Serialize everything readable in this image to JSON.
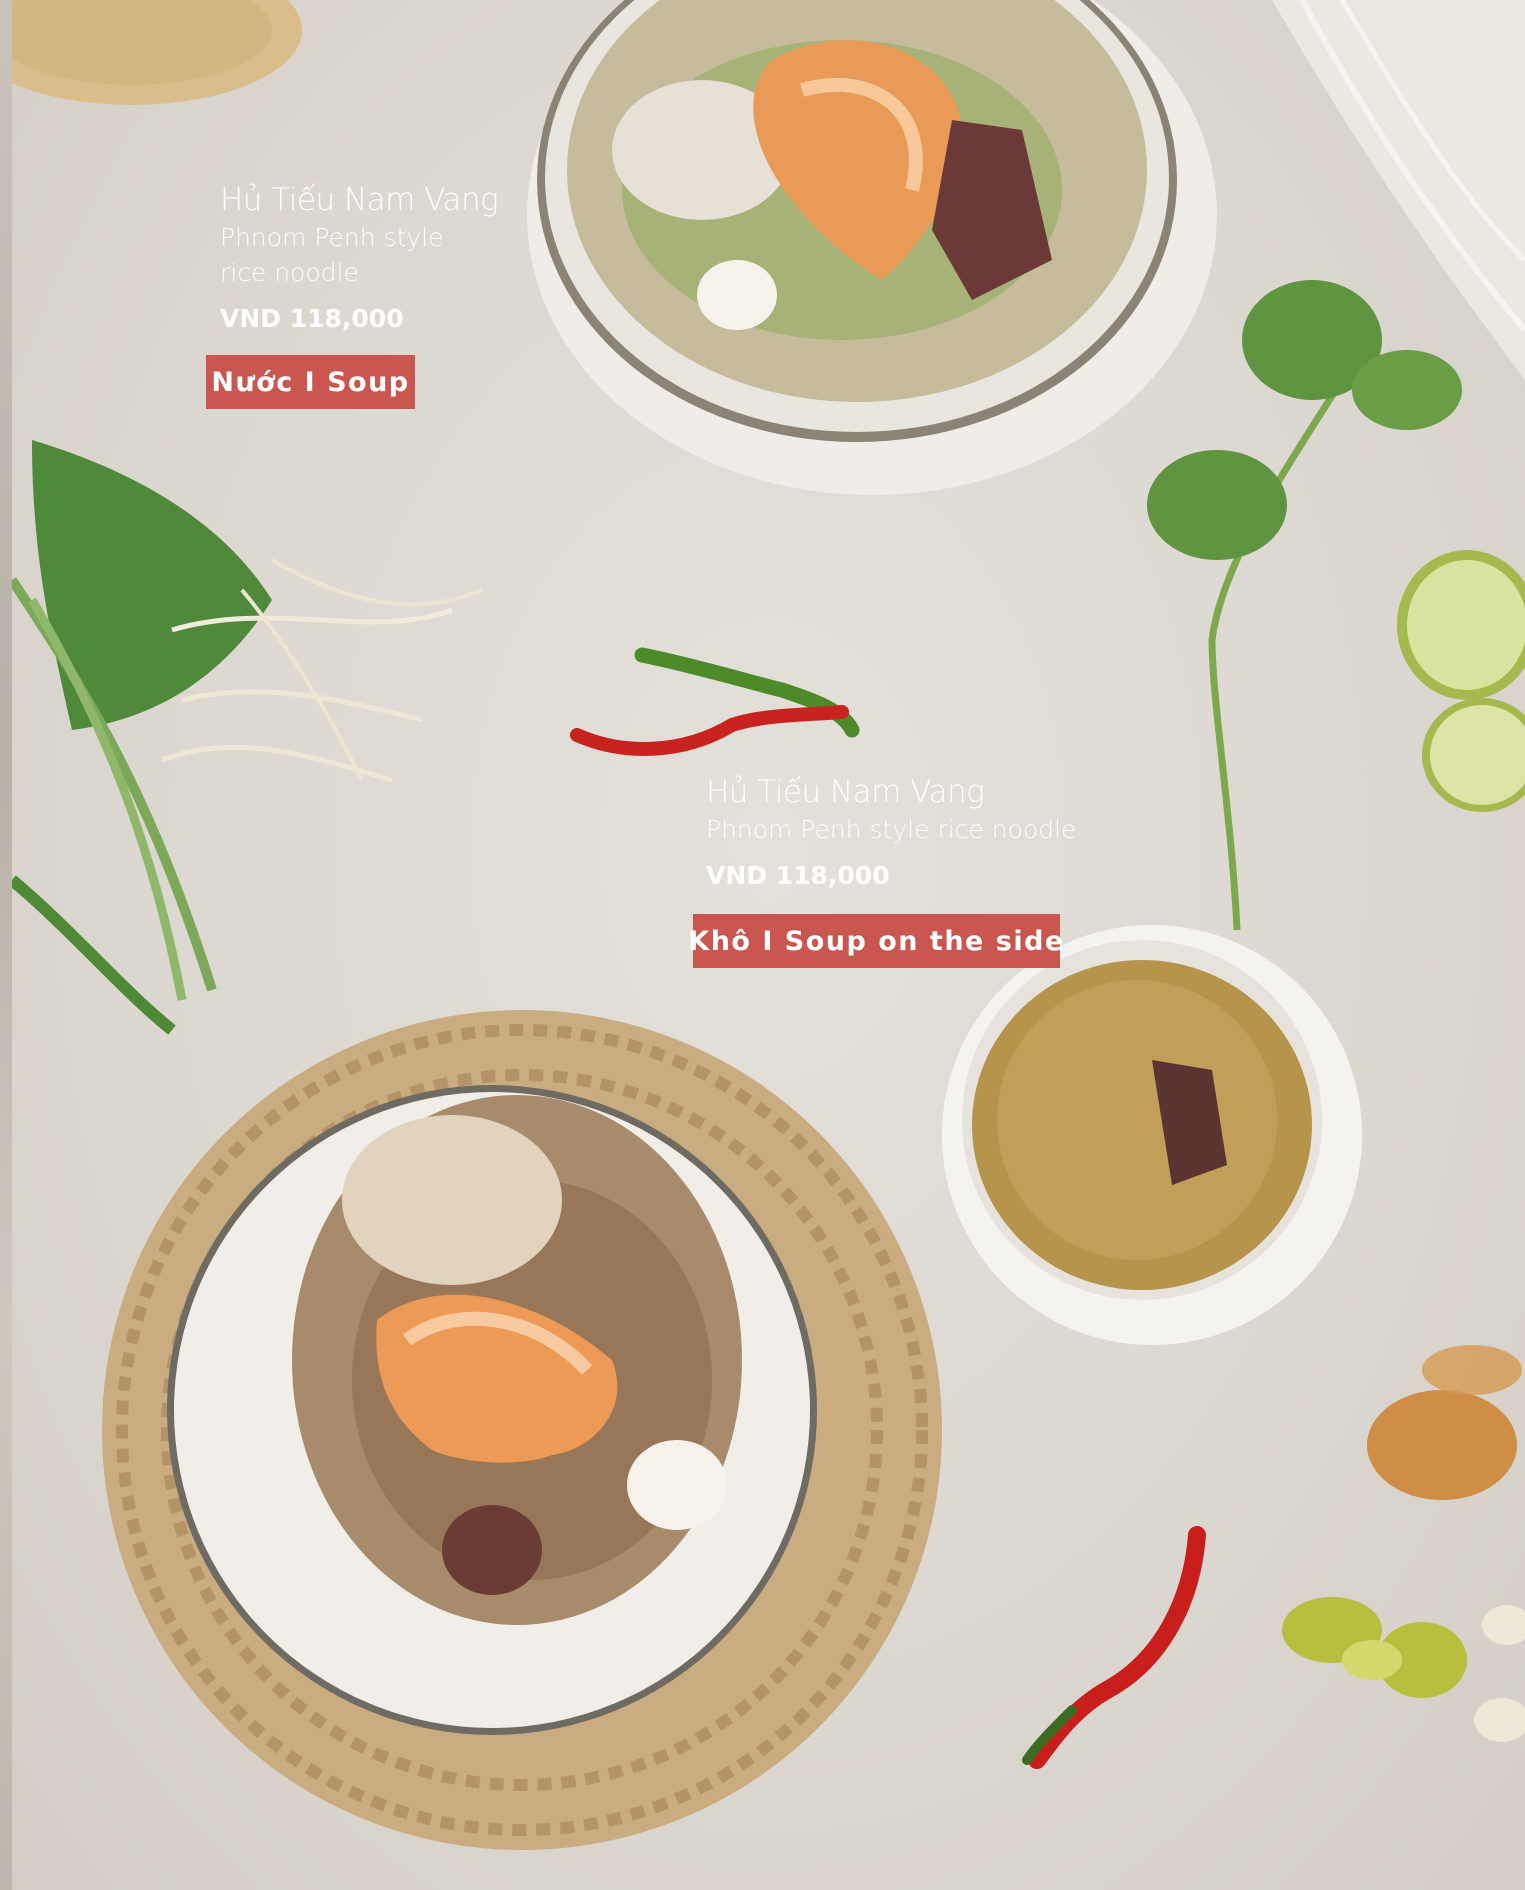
{
  "items": [
    {
      "name": "Hủ Tiếu Nam Vang",
      "description_lines": [
        "Phnom Penh style",
        "rice noodle"
      ],
      "price": "VND 118,000",
      "style_tag": "Nước I Soup"
    },
    {
      "name": "Hủ Tiếu Nam Vang",
      "description": "Phnom Penh style rice noodle",
      "price": "VND 118,000",
      "style_tag": "Khô I Soup on the side"
    }
  ],
  "colors": {
    "tag_background": "#c9574f",
    "text": "#ffffff",
    "backdrop": "#dcd7d0"
  }
}
